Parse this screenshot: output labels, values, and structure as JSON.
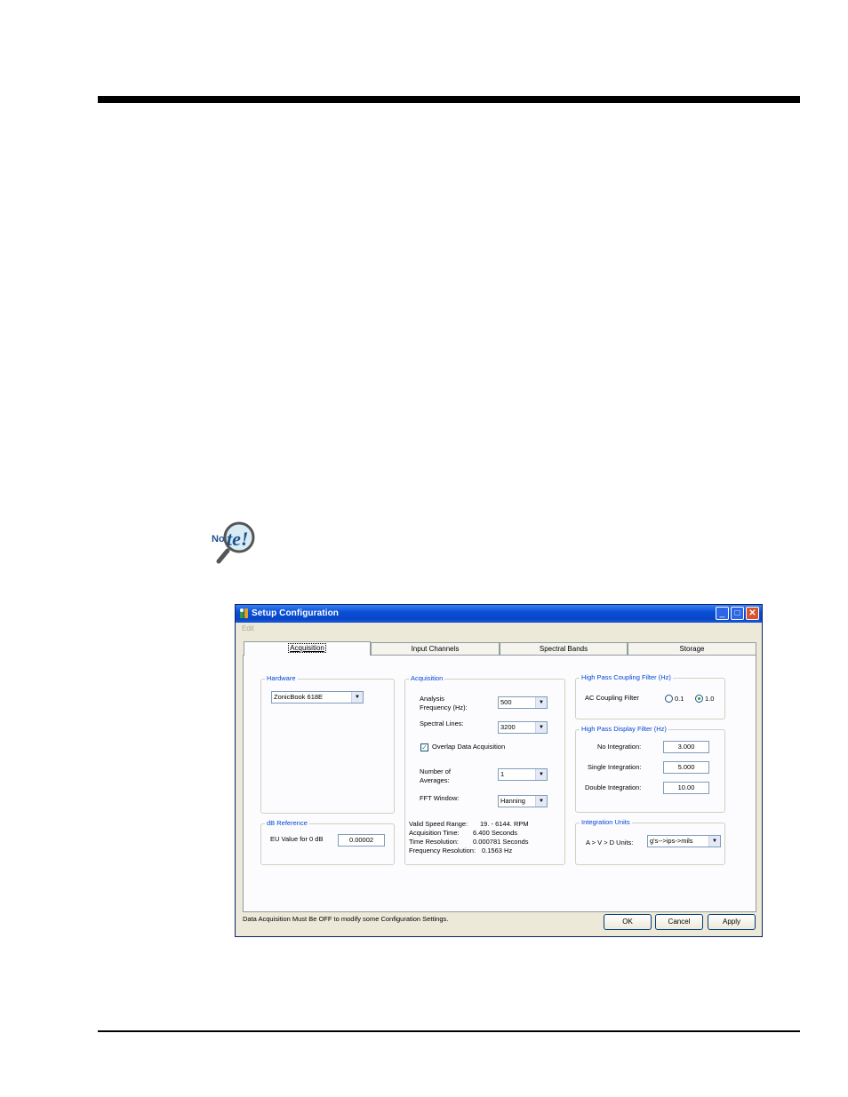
{
  "window": {
    "title": "Setup Configuration",
    "menu_edit": "Edit",
    "minimize": "_",
    "maximize": "□",
    "close": "✕"
  },
  "tabs": [
    {
      "label": "Acquisition",
      "active": true
    },
    {
      "label": "Input Channels"
    },
    {
      "label": "Spectral Bands"
    },
    {
      "label": "Storage"
    }
  ],
  "hardware": {
    "group_label": "Hardware",
    "selected": "ZonicBook 618E"
  },
  "db_reference": {
    "group_label": "dB Reference",
    "label": "EU Value for 0 dB",
    "value": "0.00002"
  },
  "acquisition": {
    "group_label": "Acquisition",
    "analysis_freq_label_1": "Analysis",
    "analysis_freq_label_2": "Frequency (Hz):",
    "analysis_freq_value": "500",
    "spectral_lines_label": "Spectral Lines:",
    "spectral_lines_value": "3200",
    "overlap_label": "Overlap Data Acquisition",
    "overlap_checked": true,
    "averages_label_1": "Number of",
    "averages_label_2": "Averages:",
    "averages_value": "1",
    "fft_window_label": "FFT Window:",
    "fft_window_value": "Hanning",
    "valid_speed_label": "Valid Speed Range:",
    "valid_speed_value": "19. - 6144. RPM",
    "acq_time_label": "Acquisition Time:",
    "acq_time_value": "6.400 Seconds",
    "time_res_label": "Time Resolution:",
    "time_res_value": "0.000781 Seconds",
    "freq_res_label": "Frequency Resolution:",
    "freq_res_value": "0.1563 Hz"
  },
  "hp_coupling": {
    "group_label": "High Pass Coupling Filter (Hz)",
    "label": "AC Coupling Filter",
    "option_1": "0.1",
    "option_2": "1.0",
    "selected": "1.0"
  },
  "hp_display": {
    "group_label": "High Pass Display Filter (Hz)",
    "no_int_label": "No Integration:",
    "no_int_value": "3.000",
    "single_int_label": "Single Integration:",
    "single_int_value": "5.000",
    "double_int_label": "Double Integration:",
    "double_int_value": "10.00"
  },
  "integration_units": {
    "group_label": "Integration Units",
    "label": "A > V > D  Units:",
    "value": "g's-->ips->mils"
  },
  "status_text": "Data Acquisition Must Be OFF to modify some Configuration Settings.",
  "buttons": {
    "ok": "OK",
    "cancel": "Cancel",
    "apply": "Apply"
  },
  "colors": {
    "titlebar": "#0a4fd6",
    "group_label": "#0046d5",
    "dialog_bg": "#ece9d8"
  }
}
